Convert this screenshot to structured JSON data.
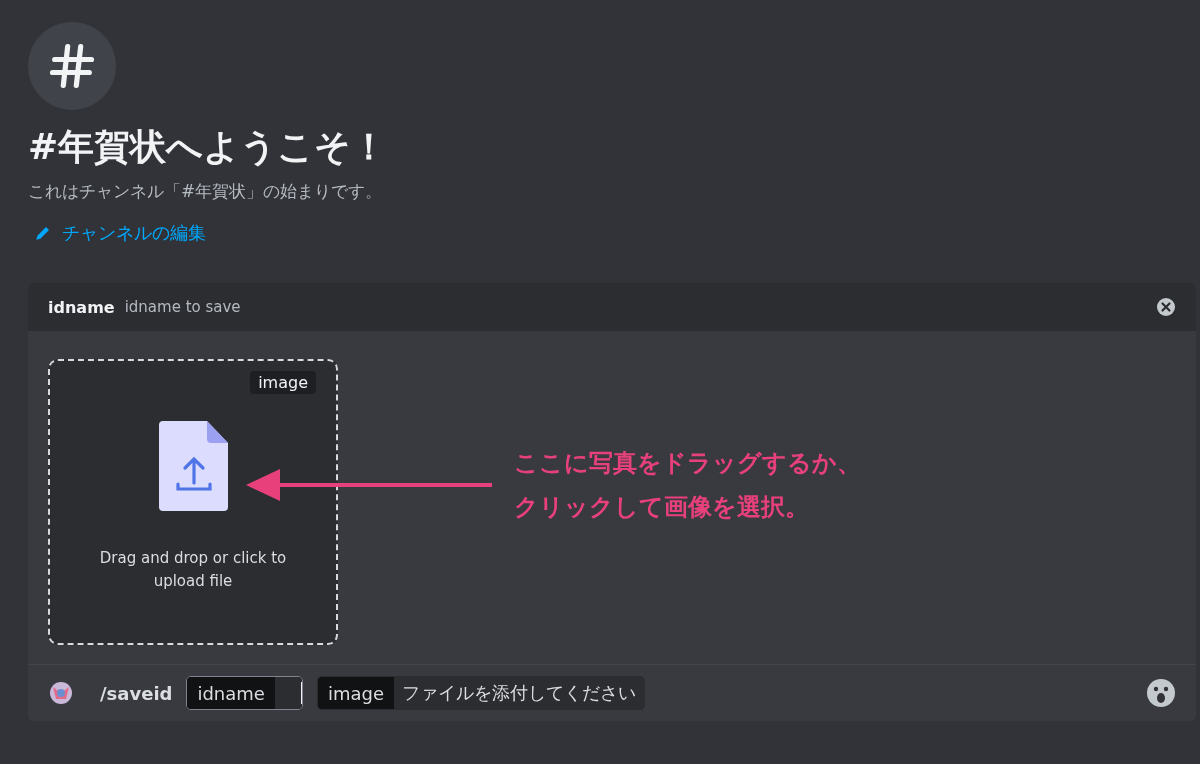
{
  "channel": {
    "title": "#年賀状へようこそ！",
    "subtitle": "これはチャンネル「#年賀状」の始まりです。",
    "edit_link": "チャンネルの編集"
  },
  "command_panel": {
    "name": "idname",
    "description": "idname to save",
    "upload": {
      "tag": "image",
      "hint": "Drag and drop or click to upload file"
    },
    "annotation": [
      "ここに写真をドラッグするか、",
      "クリックして画像を選択。"
    ],
    "command": "/saveid",
    "options": [
      {
        "kind": "text",
        "name": "idname",
        "focused": true
      },
      {
        "kind": "attachment",
        "name": "image",
        "placeholder": "ファイルを添付してください"
      }
    ]
  }
}
